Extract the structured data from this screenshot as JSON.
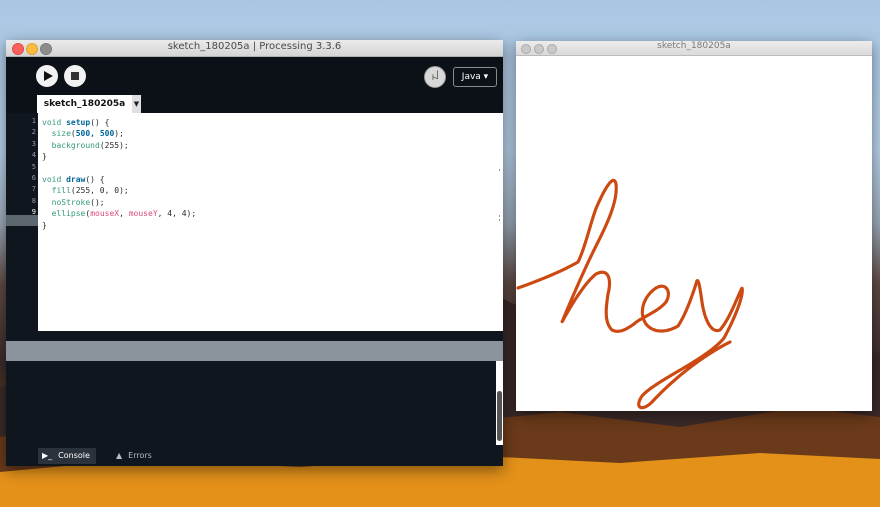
{
  "ide": {
    "title": "sketch_180205a | Processing 3.3.6",
    "mode": "Java",
    "mode_icon_glyph": "ꈤ",
    "tab_name": "sketch_180205a",
    "tab_menu_glyph": "▼",
    "line_numbers": [
      "1",
      "2",
      "3",
      "4",
      "5",
      "6",
      "7",
      "8",
      "9"
    ],
    "code_lines": [
      [
        {
          "t": "void ",
          "c": "kw"
        },
        {
          "t": "setup",
          "c": "fn"
        },
        {
          "t": "() {",
          "c": ""
        }
      ],
      [
        {
          "t": "  ",
          "c": ""
        },
        {
          "t": "size",
          "c": "kw"
        },
        {
          "t": "(",
          "c": ""
        },
        {
          "t": "500, 500",
          "c": "fn"
        },
        {
          "t": ");",
          "c": ""
        }
      ],
      [
        {
          "t": "  ",
          "c": ""
        },
        {
          "t": "background",
          "c": "kw"
        },
        {
          "t": "(255);",
          "c": ""
        }
      ],
      [
        {
          "t": "}",
          "c": ""
        }
      ],
      [
        {
          "t": "",
          "c": ""
        }
      ],
      [
        {
          "t": "void ",
          "c": "kw"
        },
        {
          "t": "draw",
          "c": "fn"
        },
        {
          "t": "() {",
          "c": ""
        }
      ],
      [
        {
          "t": "  ",
          "c": ""
        },
        {
          "t": "fill",
          "c": "kw"
        },
        {
          "t": "(255, 0, 0);",
          "c": ""
        }
      ],
      [
        {
          "t": "  ",
          "c": ""
        },
        {
          "t": "noStroke",
          "c": "kw"
        },
        {
          "t": "();",
          "c": ""
        }
      ],
      [
        {
          "t": "  ",
          "c": ""
        },
        {
          "t": "ellipse",
          "c": "kw"
        },
        {
          "t": "(",
          "c": ""
        },
        {
          "t": "mouseX",
          "c": "var"
        },
        {
          "t": ", ",
          "c": ""
        },
        {
          "t": "mouseY",
          "c": "var"
        },
        {
          "t": ", 4, 4);",
          "c": ""
        }
      ],
      [
        {
          "t": "}",
          "c": ""
        }
      ]
    ],
    "console_tab": "Console",
    "errors_tab": "Errors"
  },
  "sketch": {
    "title": "sketch_180205a",
    "drawn_text": "hey",
    "stroke_color": "#cc4a12"
  },
  "icons": {
    "run": "play-icon",
    "stop": "stop-icon",
    "console": "console-icon",
    "errors": "warning-icon"
  },
  "colors": {
    "ide_background": "#10161d",
    "keyword": "#33997e",
    "function": "#006699",
    "variable": "#d94a7a",
    "sketch_stroke": "#cc4a12"
  }
}
